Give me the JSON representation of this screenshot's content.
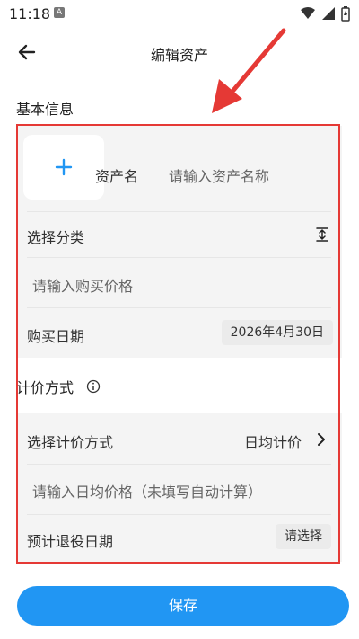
{
  "status_bar": {
    "time": "11:18",
    "indicator": "A"
  },
  "app_bar": {
    "title": "编辑资产"
  },
  "basic_info": {
    "section_title": "基本信息",
    "asset_name_label": "资产名",
    "asset_name_placeholder": "请输入资产名称",
    "category_label": "选择分类",
    "price_placeholder": "请输入购买价格",
    "purchase_date_label": "购买日期",
    "purchase_date_value": "2026年4月30日"
  },
  "pricing": {
    "section_title": "计价方式",
    "method_label": "选择计价方式",
    "method_value": "日均计价",
    "daily_price_placeholder": "请输入日均价格（未填写自动计算）",
    "retire_date_label": "预计退役日期",
    "retire_date_value": "请选择"
  },
  "footer": {
    "save_label": "保存"
  },
  "colors": {
    "accent": "#2196f3",
    "annotation": "#e53935"
  },
  "icons": {
    "back": "arrow-left-icon",
    "add": "plus-icon",
    "category": "expand-vertical-icon",
    "info": "info-circle-icon",
    "chevron": "chevron-right-icon"
  }
}
